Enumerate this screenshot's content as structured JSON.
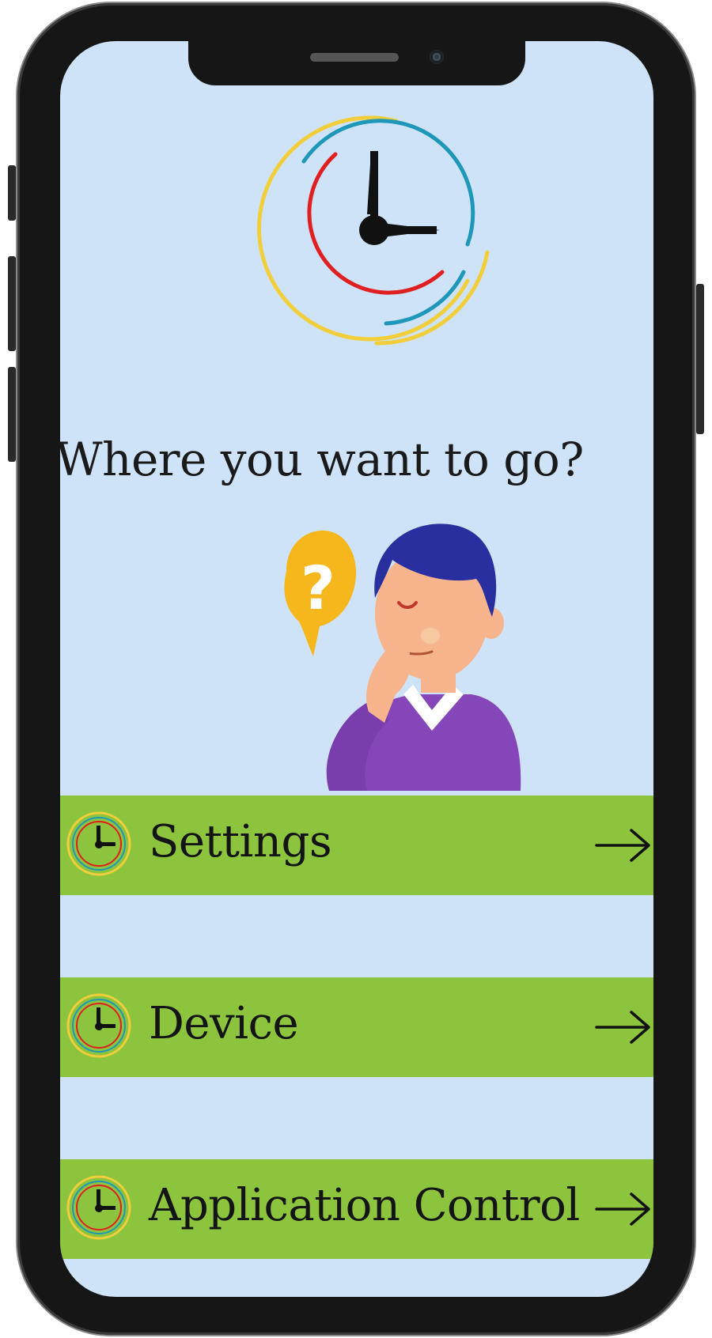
{
  "screen": {
    "headline": "Where you want to go?"
  },
  "menu": {
    "items": [
      {
        "label": "Settings",
        "icon": "clock-icon",
        "trailing_icon": "arrow-right-icon"
      },
      {
        "label": "Device",
        "icon": "clock-icon",
        "trailing_icon": "arrow-right-icon"
      },
      {
        "label": "Application Control",
        "icon": "clock-icon",
        "trailing_icon": "arrow-right-icon"
      }
    ]
  },
  "colors": {
    "background": "#cfe3f8",
    "menu_item": "#8cc43e",
    "logo_yellow": "#f2cf3a",
    "logo_blue": "#1f97b8",
    "logo_red": "#e02020"
  },
  "illustrations": {
    "logo": "clock-logo",
    "hero": "thinking-person-with-question-bubble"
  }
}
